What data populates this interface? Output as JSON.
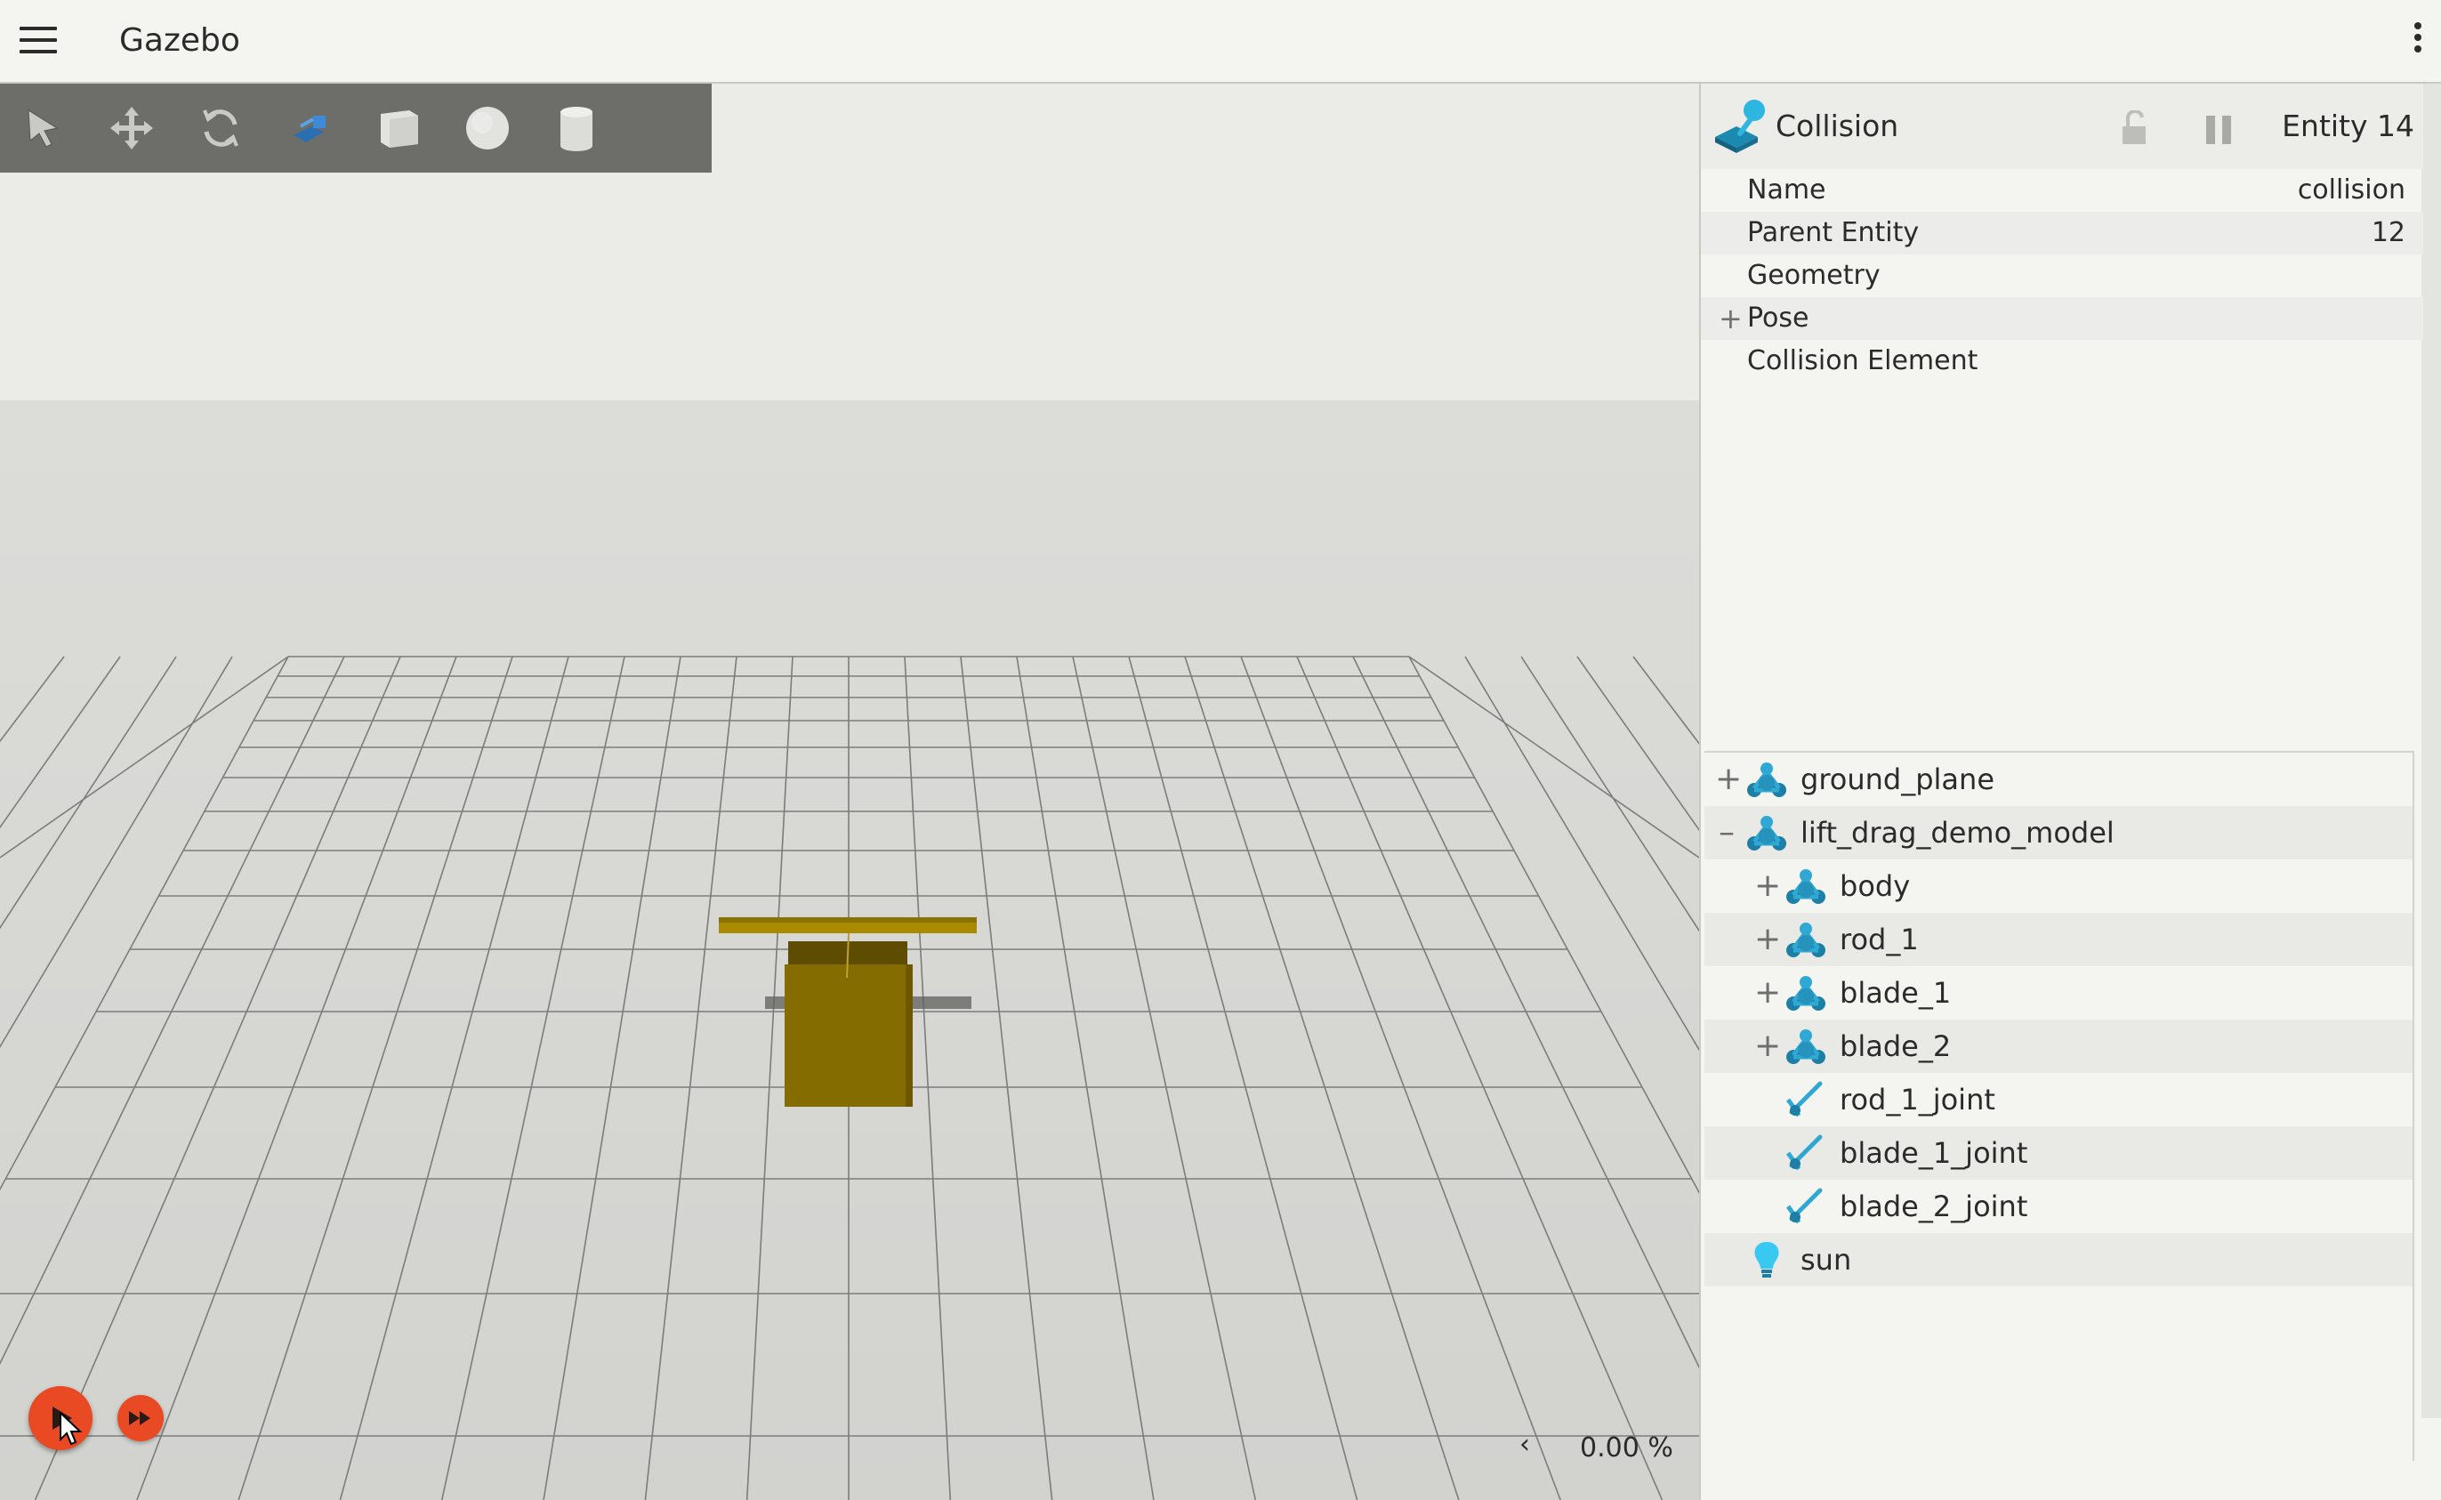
{
  "app": {
    "title": "Gazebo"
  },
  "toolbar": {
    "tools": [
      "select-tool",
      "translate-tool",
      "rotate-tool",
      "transform-control-tool",
      "box-shape",
      "sphere-shape",
      "cylinder-shape"
    ]
  },
  "viewport": {
    "colors": {
      "box": "#8a7000",
      "blade": "#a98a00",
      "grid": "#7c7c7c"
    }
  },
  "playback": {
    "play_icon": "play-icon",
    "step_icon": "fast-forward-icon",
    "rtf": "0.00 %",
    "rtf_toggle": "‹"
  },
  "component_inspector": {
    "title": "Collision",
    "entity": "Entity 14",
    "properties": [
      {
        "label": "Name",
        "value": "collision"
      },
      {
        "label": "Parent Entity",
        "value": "12"
      },
      {
        "label": "Geometry",
        "value": ""
      },
      {
        "label": "Pose",
        "value": "",
        "expand": "+"
      },
      {
        "label": "Collision Element",
        "value": ""
      }
    ]
  },
  "entity_tree": {
    "items": [
      {
        "label": "ground_plane",
        "expander": "+",
        "icon": "model-icon"
      },
      {
        "label": "lift_drag_demo_model",
        "expander": "–",
        "icon": "model-icon"
      },
      {
        "label": "body",
        "expander": "+",
        "icon": "link-icon"
      },
      {
        "label": "rod_1",
        "expander": "+",
        "icon": "link-icon"
      },
      {
        "label": "blade_1",
        "expander": "+",
        "icon": "link-icon"
      },
      {
        "label": "blade_2",
        "expander": "+",
        "icon": "link-icon"
      },
      {
        "label": "rod_1_joint",
        "expander": "",
        "icon": "joint-icon"
      },
      {
        "label": "blade_1_joint",
        "expander": "",
        "icon": "joint-icon"
      },
      {
        "label": "blade_2_joint",
        "expander": "",
        "icon": "joint-icon"
      },
      {
        "label": "sun",
        "expander": "",
        "icon": "light-bulb-icon"
      }
    ]
  }
}
